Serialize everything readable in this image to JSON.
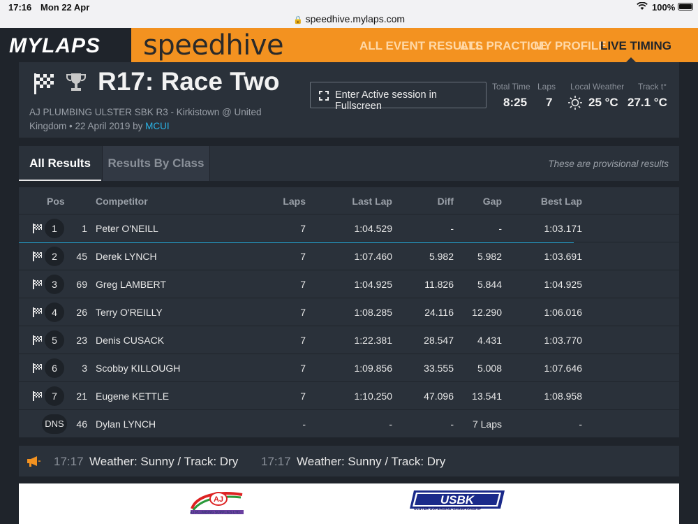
{
  "status_bar": {
    "time": "17:16",
    "date": "Mon 22 Apr",
    "url": "speedhive.mylaps.com",
    "battery": "100%"
  },
  "header": {
    "logo": "MYLAPS",
    "brand": "speedhive",
    "nav": [
      "ALL EVENT RESULTS",
      "ALL PRACTICE",
      "MY PROFILE",
      "LIVE TIMING"
    ],
    "accent": "#f39220"
  },
  "session": {
    "title": "R17: Race Two",
    "subtitle": "AJ PLUMBING ULSTER SBK R3 - Kirkistown @ United Kingdom • 22 April 2019 by",
    "by": "MCUI",
    "fullscreen_label": "Enter Active session in Fullscreen",
    "stats": {
      "total_time_label": "Total Time",
      "total_time": "8:25",
      "laps_label": "Laps",
      "laps": "7",
      "weather_label": "Local Weather",
      "weather": "25 °C",
      "track_label": "Track t°",
      "track": "27.1 °C"
    }
  },
  "tabs": {
    "all": "All Results",
    "by_class": "Results By Class",
    "provisional": "These are provisional results"
  },
  "table": {
    "headers": {
      "pos": "Pos",
      "competitor": "Competitor",
      "laps": "Laps",
      "last_lap": "Last Lap",
      "diff": "Diff",
      "gap": "Gap",
      "best_lap": "Best Lap"
    },
    "rows": [
      {
        "pos": "1",
        "num": "1",
        "name": "Peter O'NEILL",
        "laps": "7",
        "last": "1:04.529",
        "diff": "-",
        "gap": "-",
        "best": "1:03.171"
      },
      {
        "pos": "2",
        "num": "45",
        "name": "Derek LYNCH",
        "laps": "7",
        "last": "1:07.460",
        "diff": "5.982",
        "gap": "5.982",
        "best": "1:03.691"
      },
      {
        "pos": "3",
        "num": "69",
        "name": "Greg LAMBERT",
        "laps": "7",
        "last": "1:04.925",
        "diff": "11.826",
        "gap": "5.844",
        "best": "1:04.925"
      },
      {
        "pos": "4",
        "num": "26",
        "name": "Terry O'REILLY",
        "laps": "7",
        "last": "1:08.285",
        "diff": "24.116",
        "gap": "12.290",
        "best": "1:06.016"
      },
      {
        "pos": "5",
        "num": "23",
        "name": "Denis CUSACK",
        "laps": "7",
        "last": "1:22.381",
        "diff": "28.547",
        "gap": "4.431",
        "best": "1:03.770"
      },
      {
        "pos": "6",
        "num": "3",
        "name": "Scobby KILLOUGH",
        "laps": "7",
        "last": "1:09.856",
        "diff": "33.555",
        "gap": "5.008",
        "best": "1:07.646"
      },
      {
        "pos": "7",
        "num": "21",
        "name": "Eugene KETTLE",
        "laps": "7",
        "last": "1:10.250",
        "diff": "47.096",
        "gap": "13.541",
        "best": "1:08.958"
      },
      {
        "pos": "DNS",
        "num": "46",
        "name": "Dylan LYNCH",
        "laps": "-",
        "last": "-",
        "diff": "-",
        "gap": "7 Laps",
        "best": "-"
      }
    ]
  },
  "ticker": [
    {
      "time": "17:17",
      "msg": "Weather: Sunny / Track: Dry"
    },
    {
      "time": "17:17",
      "msg": "Weather: Sunny / Track: Dry"
    }
  ],
  "sponsors": {
    "aj": "AJ PLUMBING SUPPLIES LTD.",
    "aj_mark": "AJ",
    "usbk": "USBK",
    "usbk_sub": "ULSTER SUPERBIKE CHAMPIONSHIP"
  }
}
